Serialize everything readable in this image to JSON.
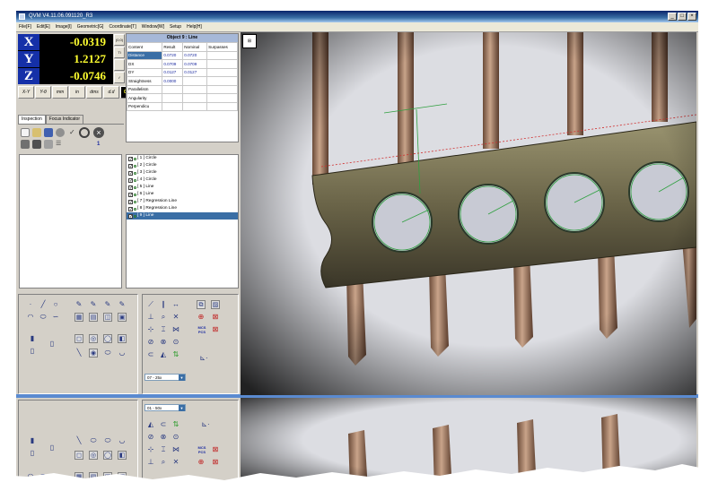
{
  "app": {
    "title": "QVM V4.11.06.091120_R3"
  },
  "menu": [
    "File[F]",
    "Edit[E]",
    "Image[I]",
    "Geometric[G]",
    "Coordinate[T]",
    "Window[W]",
    "Setup",
    "Help[H]"
  ],
  "dro": [
    {
      "axis": "X",
      "value": "-0.0319"
    },
    {
      "axis": "Y",
      "value": "1.2127"
    },
    {
      "axis": "Z",
      "value": "-0.0746"
    }
  ],
  "side_buttons": [
    "(0,0)",
    "Ti",
    "",
    "✓"
  ],
  "unit_buttons": [
    "X-Y",
    "Y-θ",
    "mm",
    "in",
    "dms",
    "d.d",
    "0:4:0:2",
    "3"
  ],
  "tabs": [
    "Inspection",
    "Focus Indicator"
  ],
  "tabpanel_number": "1",
  "object": {
    "title": "Object 9 : Line",
    "headers": [
      "Content",
      "Result",
      "Nominal",
      "Surpasses"
    ],
    "rows": [
      [
        "Distance",
        "0.0720",
        "0.0720",
        ""
      ],
      [
        "DX",
        "0.0709",
        "0.0709",
        ""
      ],
      [
        "DY",
        "0.0127",
        "0.0127",
        ""
      ],
      [
        "Straightness",
        "0.0000",
        "",
        ""
      ],
      [
        "Parallelism",
        "",
        "",
        ""
      ],
      [
        "Angularity",
        "",
        "",
        ""
      ],
      [
        "Perpendicu",
        "",
        "",
        ""
      ]
    ]
  },
  "features": [
    "[ 1 ] Circle",
    "[ 2 ] Circle",
    "[ 3 ] Circle",
    "[ 4 ] Circle",
    "[ 5 ] Line",
    "[ 6 ] Line",
    "[ 7 ] Regression Line",
    "[ 8 ] Regression Line",
    "[ 9 ] Line"
  ],
  "selected_feature_index": 8,
  "zoom_combo_top": "07 - 25x",
  "zoom_combo_bottom": "01 - 50x",
  "tool_labels": {
    "mcs_pcs": "MCS PCS"
  },
  "colors": {
    "dro_axis_bg": "#1530a8",
    "dro_text": "#ffff30",
    "selection": "#3a6ea5",
    "annotation_red": "#d03030",
    "annotation_green": "#30a040"
  }
}
